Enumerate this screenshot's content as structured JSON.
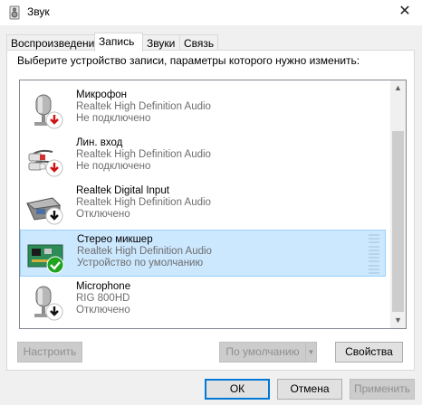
{
  "window": {
    "title": "Звук",
    "close_glyph": "✕"
  },
  "tabs": [
    {
      "label": "Воспроизведение",
      "active": false
    },
    {
      "label": "Запись",
      "active": true
    },
    {
      "label": "Звуки",
      "active": false
    },
    {
      "label": "Связь",
      "active": false
    }
  ],
  "instruction": "Выберите устройство записи, параметры которого нужно изменить:",
  "devices": [
    {
      "name": "Микрофон",
      "driver": "Realtek High Definition Audio",
      "status": "Не подключено",
      "icon": "microphone-icon",
      "badge": "red-down-arrow",
      "selected": false
    },
    {
      "name": "Лин. вход",
      "driver": "Realtek High Definition Audio",
      "status": "Не подключено",
      "icon": "line-in-cable-icon",
      "badge": "red-down-arrow",
      "selected": false
    },
    {
      "name": "Realtek Digital Input",
      "driver": "Realtek High Definition Audio",
      "status": "Отключено",
      "icon": "digital-input-icon",
      "badge": "black-down-arrow",
      "selected": false
    },
    {
      "name": "Стерео микшер",
      "driver": "Realtek High Definition Audio",
      "status": "Устройство по умолчанию",
      "icon": "sound-card-icon",
      "badge": "green-check",
      "selected": true
    },
    {
      "name": "Microphone",
      "driver": "RIG 800HD",
      "status": "Отключено",
      "icon": "microphone-icon",
      "badge": "black-down-arrow",
      "selected": false
    }
  ],
  "buttons": {
    "configure": "Настроить",
    "set_default": "По умолчанию",
    "properties": "Свойства",
    "ok": "ОК",
    "cancel": "Отмена",
    "apply": "Применить"
  },
  "colors": {
    "selection_bg": "#cce8ff",
    "selection_border": "#99d1ff",
    "accent": "#0078d7"
  }
}
